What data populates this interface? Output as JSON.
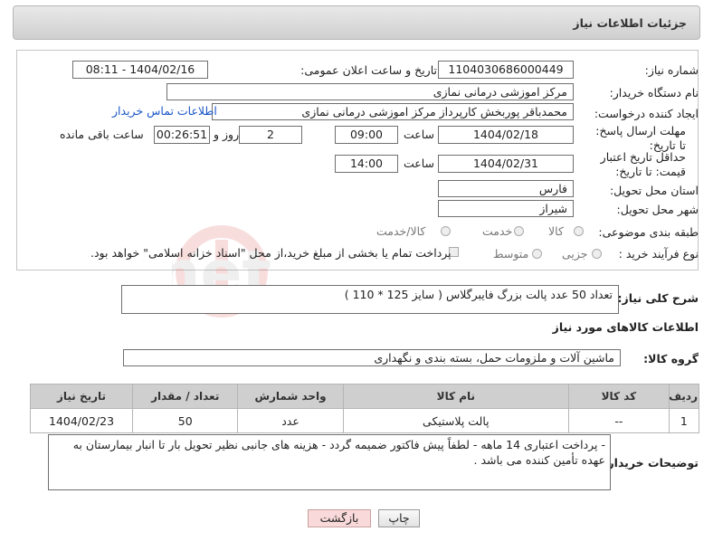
{
  "header": {
    "title": "جزئیات اطلاعات نیاز"
  },
  "need": {
    "number_label": "شماره نیاز:",
    "number": "1104030686000449",
    "announce_label": "تاریخ و ساعت اعلان عمومی:",
    "announce_value": "1404/02/16 - 08:11",
    "buyer_org_label": "نام دستگاه خریدار:",
    "buyer_org": "مرکز اموزشی درمانی نمازی",
    "creator_label": "ایجاد کننده درخواست:",
    "creator": "محمدباقر پوربخش کارپرداز مرکز اموزشی درمانی نمازی",
    "contact_link": "اطلاعات تماس خریدار",
    "deadline_label": "مهلت ارسال پاسخ: تا تاریخ:",
    "deadline_date": "1404/02/18",
    "time_label": "ساعت",
    "deadline_time": "09:00",
    "days": "2",
    "days_label": "روز و",
    "remaining": "00:26:51",
    "remaining_label": "ساعت باقی مانده",
    "min_price_label": "حداقل تاریخ اعتبار قیمت: تا تاریخ:",
    "min_price_date": "1404/02/31",
    "min_price_time": "14:00",
    "province_label": "استان محل تحویل:",
    "province": "فارس",
    "city_label": "شهر محل تحویل:",
    "city": "شیراز",
    "category_label": "طبقه بندی موضوعی:",
    "category_options": [
      "کالا",
      "خدمت",
      "کالا/خدمت"
    ],
    "process_label": "نوع فرآیند خرید :",
    "process_options": [
      "جزیی",
      "متوسط"
    ],
    "payment_note": "پرداخت تمام یا بخشی از مبلغ خرید،از محل \"اسناد خزانه اسلامی\" خواهد بود."
  },
  "description": {
    "label": "شرح کلی نیاز:",
    "text": "تعداد 50 عدد پالت بزرگ فایبرگلاس ( سایز 125 * 110 )"
  },
  "goods": {
    "section_title": "اطلاعات کالاهای مورد نیاز",
    "group_label": "گروه کالا:",
    "group_value": "ماشین آلات و ملزومات حمل، بسته بندی و نگهداری",
    "columns": [
      "ردیف",
      "کد کالا",
      "نام کالا",
      "واحد شمارش",
      "تعداد / مقدار",
      "تاریخ نیاز"
    ],
    "rows": [
      {
        "row": "1",
        "code": "--",
        "name": "پالت پلاستیکی",
        "unit": "عدد",
        "qty": "50",
        "date": "1404/02/23"
      }
    ]
  },
  "buyer_notes": {
    "label": "توضیحات خریدار:",
    "text": "- پرداخت اعتباری 14 ماهه - لطفاً پیش فاکتور ضمیمه گردد - هزینه های جانبی نظیر تحویل بار تا انبار بیمارستان به عهده تأمین کننده می باشد ."
  },
  "buttons": {
    "print": "چاپ",
    "back": "بازگشت"
  },
  "watermark": "AriaTender.net",
  "colors": {
    "link": "#1a56c8",
    "header_bg": "#d6d6d6",
    "table_header": "#cfcfcf",
    "back_button_bg": "#f9d9d9"
  }
}
